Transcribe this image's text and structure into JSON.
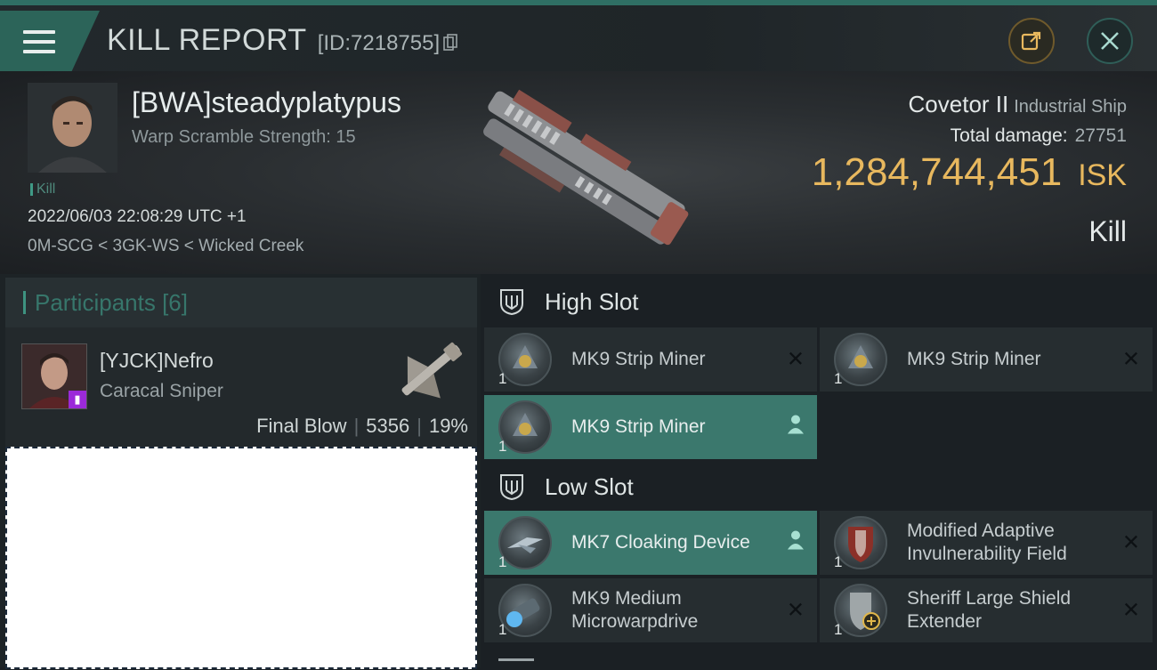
{
  "header": {
    "title": "KILL REPORT",
    "report_id": "[ID:7218755]"
  },
  "victim": {
    "name": "[BWA]steadyplatypus",
    "warp_scramble": "Warp Scramble Strength: 15",
    "tag": "Kill",
    "datetime": "2022/06/03 22:08:29 UTC +1",
    "location": "0M-SCG < 3GK-WS < Wicked Creek",
    "ship_name": "Covetor II",
    "ship_class": "Industrial Ship",
    "damage_label": "Total damage:",
    "damage_value": "27751",
    "isk_value": "1,284,744,451",
    "isk_label": "ISK",
    "result": "Kill"
  },
  "participants": {
    "header": "Participants [6]",
    "items": [
      {
        "name": "[YJCK]Nefro",
        "ship": "Caracal Sniper",
        "role": "Final Blow",
        "damage": "5356",
        "percent": "19%"
      }
    ]
  },
  "fitting": {
    "high_slot": {
      "label": "High Slot",
      "modules": [
        {
          "name": "MK9 Strip Miner",
          "qty": "1",
          "status": "destroyed"
        },
        {
          "name": "MK9 Strip Miner",
          "qty": "1",
          "status": "destroyed"
        },
        {
          "name": "MK9 Strip Miner",
          "qty": "1",
          "status": "dropped"
        }
      ]
    },
    "low_slot": {
      "label": "Low Slot",
      "modules": [
        {
          "name": "MK7 Cloaking Device",
          "qty": "1",
          "status": "dropped"
        },
        {
          "name": "Modified Adaptive Invulnerability Field",
          "qty": "1",
          "status": "destroyed"
        },
        {
          "name": "MK9 Medium Microwarpdrive",
          "qty": "1",
          "status": "destroyed"
        },
        {
          "name": "Sheriff Large Shield Extender",
          "qty": "1",
          "status": "destroyed"
        }
      ]
    },
    "status_destroyed_glyph": "✕"
  },
  "colors": {
    "accent": "#2f6f64",
    "selected_row": "#3b786d",
    "isk": "#e8b85e"
  }
}
